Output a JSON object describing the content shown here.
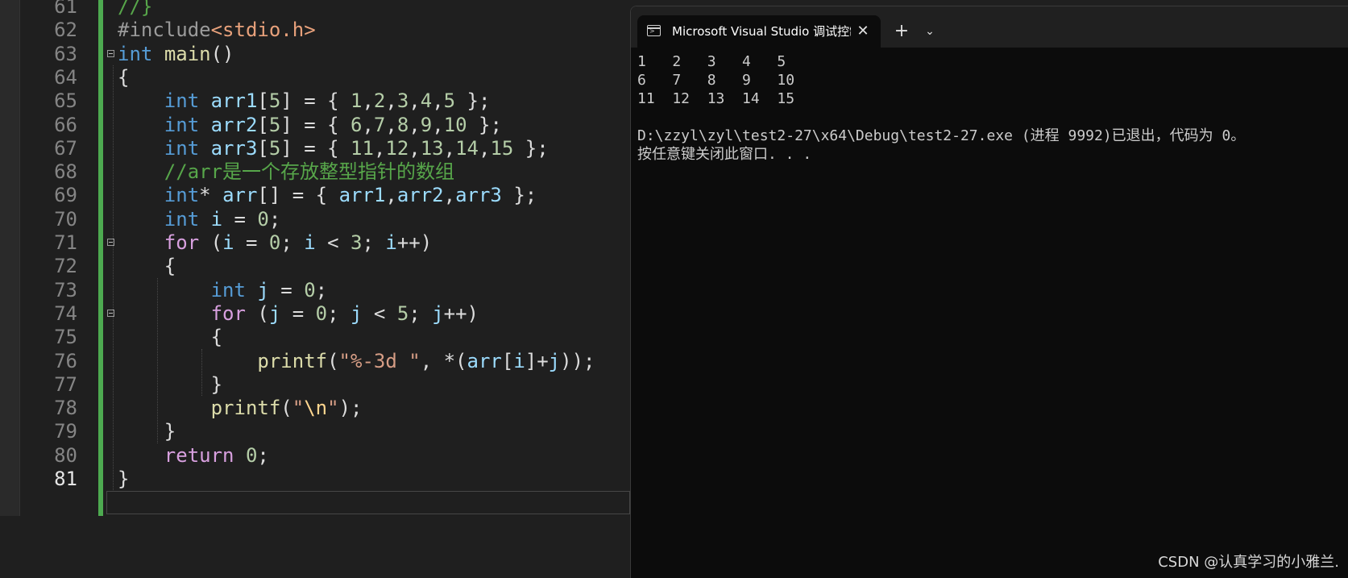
{
  "editor": {
    "lines": [
      {
        "no": "61",
        "tokens": [
          {
            "t": "//}",
            "c": "cmt"
          }
        ]
      },
      {
        "no": "62",
        "tokens": [
          {
            "t": "#include",
            "c": "pre"
          },
          {
            "t": "<stdio.h>",
            "c": "hdr"
          }
        ]
      },
      {
        "no": "63",
        "fold": true,
        "tokens": [
          {
            "t": "int",
            "c": "kw"
          },
          {
            "t": " "
          },
          {
            "t": "main",
            "c": "fn"
          },
          {
            "t": "()"
          }
        ]
      },
      {
        "no": "64",
        "tokens": [
          {
            "t": "{"
          }
        ]
      },
      {
        "no": "65",
        "tokens": [
          {
            "t": "    "
          },
          {
            "t": "int",
            "c": "kw"
          },
          {
            "t": " "
          },
          {
            "t": "arr1",
            "c": "var"
          },
          {
            "t": "["
          },
          {
            "t": "5",
            "c": "num"
          },
          {
            "t": "] = { "
          },
          {
            "t": "1",
            "c": "num"
          },
          {
            "t": ","
          },
          {
            "t": "2",
            "c": "num"
          },
          {
            "t": ","
          },
          {
            "t": "3",
            "c": "num"
          },
          {
            "t": ","
          },
          {
            "t": "4",
            "c": "num"
          },
          {
            "t": ","
          },
          {
            "t": "5",
            "c": "num"
          },
          {
            "t": " };"
          }
        ]
      },
      {
        "no": "66",
        "tokens": [
          {
            "t": "    "
          },
          {
            "t": "int",
            "c": "kw"
          },
          {
            "t": " "
          },
          {
            "t": "arr2",
            "c": "var"
          },
          {
            "t": "["
          },
          {
            "t": "5",
            "c": "num"
          },
          {
            "t": "] = { "
          },
          {
            "t": "6",
            "c": "num"
          },
          {
            "t": ","
          },
          {
            "t": "7",
            "c": "num"
          },
          {
            "t": ","
          },
          {
            "t": "8",
            "c": "num"
          },
          {
            "t": ","
          },
          {
            "t": "9",
            "c": "num"
          },
          {
            "t": ","
          },
          {
            "t": "10",
            "c": "num"
          },
          {
            "t": " };"
          }
        ]
      },
      {
        "no": "67",
        "tokens": [
          {
            "t": "    "
          },
          {
            "t": "int",
            "c": "kw"
          },
          {
            "t": " "
          },
          {
            "t": "arr3",
            "c": "var"
          },
          {
            "t": "["
          },
          {
            "t": "5",
            "c": "num"
          },
          {
            "t": "] = { "
          },
          {
            "t": "11",
            "c": "num"
          },
          {
            "t": ","
          },
          {
            "t": "12",
            "c": "num"
          },
          {
            "t": ","
          },
          {
            "t": "13",
            "c": "num"
          },
          {
            "t": ","
          },
          {
            "t": "14",
            "c": "num"
          },
          {
            "t": ","
          },
          {
            "t": "15",
            "c": "num"
          },
          {
            "t": " };"
          }
        ]
      },
      {
        "no": "68",
        "tokens": [
          {
            "t": "    "
          },
          {
            "t": "//arr是一个存放整型指针的数组",
            "c": "cmt"
          }
        ]
      },
      {
        "no": "69",
        "tokens": [
          {
            "t": "    "
          },
          {
            "t": "int",
            "c": "kw"
          },
          {
            "t": "* "
          },
          {
            "t": "arr",
            "c": "var"
          },
          {
            "t": "[] = { "
          },
          {
            "t": "arr1",
            "c": "var"
          },
          {
            "t": ","
          },
          {
            "t": "arr2",
            "c": "var"
          },
          {
            "t": ","
          },
          {
            "t": "arr3",
            "c": "var"
          },
          {
            "t": " };"
          }
        ]
      },
      {
        "no": "70",
        "tokens": [
          {
            "t": "    "
          },
          {
            "t": "int",
            "c": "kw"
          },
          {
            "t": " "
          },
          {
            "t": "i",
            "c": "var"
          },
          {
            "t": " = "
          },
          {
            "t": "0",
            "c": "num"
          },
          {
            "t": ";"
          }
        ]
      },
      {
        "no": "71",
        "fold": true,
        "tokens": [
          {
            "t": "    "
          },
          {
            "t": "for",
            "c": "ctl"
          },
          {
            "t": " ("
          },
          {
            "t": "i",
            "c": "var"
          },
          {
            "t": " = "
          },
          {
            "t": "0",
            "c": "num"
          },
          {
            "t": "; "
          },
          {
            "t": "i",
            "c": "var"
          },
          {
            "t": " < "
          },
          {
            "t": "3",
            "c": "num"
          },
          {
            "t": "; "
          },
          {
            "t": "i",
            "c": "var"
          },
          {
            "t": "++)"
          }
        ]
      },
      {
        "no": "72",
        "tokens": [
          {
            "t": "    {"
          }
        ]
      },
      {
        "no": "73",
        "tokens": [
          {
            "t": "        "
          },
          {
            "t": "int",
            "c": "kw"
          },
          {
            "t": " "
          },
          {
            "t": "j",
            "c": "var"
          },
          {
            "t": " = "
          },
          {
            "t": "0",
            "c": "num"
          },
          {
            "t": ";"
          }
        ]
      },
      {
        "no": "74",
        "fold": true,
        "tokens": [
          {
            "t": "        "
          },
          {
            "t": "for",
            "c": "ctl"
          },
          {
            "t": " ("
          },
          {
            "t": "j",
            "c": "var"
          },
          {
            "t": " = "
          },
          {
            "t": "0",
            "c": "num"
          },
          {
            "t": "; "
          },
          {
            "t": "j",
            "c": "var"
          },
          {
            "t": " < "
          },
          {
            "t": "5",
            "c": "num"
          },
          {
            "t": "; "
          },
          {
            "t": "j",
            "c": "var"
          },
          {
            "t": "++)"
          }
        ]
      },
      {
        "no": "75",
        "tokens": [
          {
            "t": "        {"
          }
        ]
      },
      {
        "no": "76",
        "tokens": [
          {
            "t": "            "
          },
          {
            "t": "printf",
            "c": "fn"
          },
          {
            "t": "("
          },
          {
            "t": "\"%-3d \"",
            "c": "str"
          },
          {
            "t": ", *("
          },
          {
            "t": "arr",
            "c": "var"
          },
          {
            "t": "["
          },
          {
            "t": "i",
            "c": "var"
          },
          {
            "t": "]+"
          },
          {
            "t": "j",
            "c": "var"
          },
          {
            "t": "));"
          }
        ]
      },
      {
        "no": "77",
        "tokens": [
          {
            "t": "        }"
          }
        ]
      },
      {
        "no": "78",
        "tokens": [
          {
            "t": "        "
          },
          {
            "t": "printf",
            "c": "fn"
          },
          {
            "t": "("
          },
          {
            "t": "\"",
            "c": "str"
          },
          {
            "t": "\\n",
            "c": "esc"
          },
          {
            "t": "\"",
            "c": "str"
          },
          {
            "t": ");"
          }
        ]
      },
      {
        "no": "79",
        "tokens": [
          {
            "t": "    }"
          }
        ]
      },
      {
        "no": "80",
        "tokens": [
          {
            "t": "    "
          },
          {
            "t": "return",
            "c": "ctl"
          },
          {
            "t": " "
          },
          {
            "t": "0",
            "c": "num"
          },
          {
            "t": ";"
          }
        ]
      },
      {
        "no": "81",
        "current": true,
        "tokens": [
          {
            "t": "}"
          }
        ]
      }
    ]
  },
  "console": {
    "tab_title": "Microsoft Visual Studio 调试控制台",
    "close_glyph": "✕",
    "new_tab_glyph": "+",
    "dropdown_glyph": "⌄",
    "output": [
      "1   2   3   4   5",
      "6   7   8   9   10",
      "11  12  13  14  15",
      "",
      "D:\\zzyl\\zyl\\test2-27\\x64\\Debug\\test2-27.exe (进程 9992)已退出，代码为 0。",
      "按任意键关闭此窗口. . ."
    ]
  },
  "watermark": "CSDN @认真学习的小雅兰."
}
